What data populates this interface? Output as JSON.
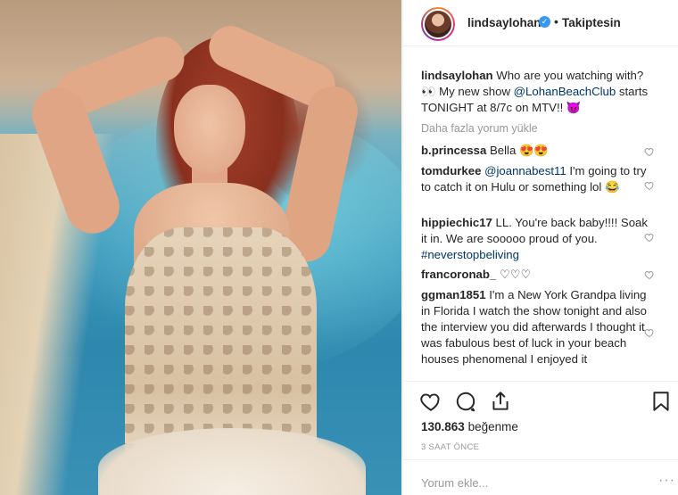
{
  "post": {
    "image_alt_label": "",
    "username": "lindsaylohan",
    "follow_status": "Takiptesin",
    "caption": {
      "user": "lindsaylohan",
      "text_1": " Who are you watching with?",
      "text_2": "👀 My new show ",
      "mention": "@LohanBeachClub",
      "text_3": " starts TONIGHT at 8/7c on MTV!! 😈"
    },
    "load_more": "Daha fazla yorum yükle",
    "comments": [
      {
        "user": "b.princessa",
        "text": "Bella 😍😍"
      },
      {
        "user": "tomdurkee",
        "mention": "@joannabest11",
        "text": " I'm going to try to catch it on Hulu or something lol 😂"
      },
      {
        "user": "hippiechic17",
        "text": " LL. You're back baby!!!! Soak it in. We are sooooo proud of you. ",
        "tag": "#neverstopbeliving"
      },
      {
        "user": "francoronab_",
        "text": " ♡♡♡"
      },
      {
        "user": "ggman1851",
        "text": " I'm a New York Grandpa living in Florida I watch the show tonight and also the interview you did afterwards I thought it was fabulous best of luck in your beach houses phenomenal I enjoyed it"
      }
    ],
    "likes_count": "130.863",
    "likes_word": "beğenme",
    "time_ago": "3 SAAT ÖNCE",
    "add_comment_placeholder": "Yorum ekle...",
    "more_label": "···"
  },
  "colors": {
    "link": "#003569",
    "muted": "#999999",
    "verified": "#3897f0"
  }
}
